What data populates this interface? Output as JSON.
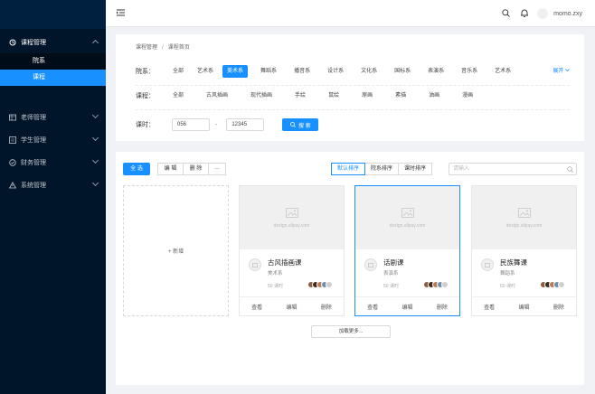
{
  "header": {
    "user_name": "momo.zxy"
  },
  "sidebar": {
    "groups": [
      {
        "label": "课程管理",
        "icon": "course-icon",
        "open": true,
        "items": [
          {
            "label": "院系"
          },
          {
            "label": "课程"
          }
        ]
      },
      {
        "label": "老师管理",
        "icon": "teacher-icon"
      },
      {
        "label": "学生管理",
        "icon": "student-icon"
      },
      {
        "label": "财务管理",
        "icon": "finance-icon"
      },
      {
        "label": "系统管理",
        "icon": "system-icon"
      }
    ]
  },
  "breadcrumb": {
    "root": "课程管理",
    "sep": "/",
    "current": "课程首页"
  },
  "filters": {
    "dept_label": "院系：",
    "depts": [
      "全部",
      "艺术系",
      "美术系",
      "舞蹈系",
      "播音系",
      "设计系",
      "文化系",
      "国标系",
      "表演系",
      "音乐系",
      "艺术系"
    ],
    "selected_dept_index": 2,
    "expand_label": "展开",
    "course_label": "课程：",
    "courses": [
      "全部",
      "古风插画",
      "现代插画",
      "手绘",
      "鼠绘",
      "原画",
      "素描",
      "油画",
      "漫画"
    ],
    "hours_label": "课时：",
    "hours_from": "056",
    "hours_sep": "-",
    "hours_to": "12345",
    "search_button": "搜 索"
  },
  "toolbar": {
    "select_all": "全 选",
    "edit": "编 辑",
    "delete": "删 除",
    "more": "···",
    "sorts": [
      "默认排序",
      "院系排序",
      "课时排序"
    ],
    "active_sort_index": 0,
    "search_placeholder": "请输入"
  },
  "add_card_label": "+ 新增",
  "cards": [
    {
      "title": "古风插画课",
      "dept": "美术系",
      "hours": "50 课时",
      "image_caption": "design.alipay.com",
      "actions": [
        "查看",
        "编辑",
        "删除"
      ],
      "active": false
    },
    {
      "title": "话剧课",
      "dept": "表演系",
      "hours": "50 课时",
      "image_caption": "design.alipay.com",
      "actions": [
        "查看",
        "编辑",
        "删除"
      ],
      "active": true
    },
    {
      "title": "民族舞课",
      "dept": "舞蹈系",
      "hours": "50 课时",
      "image_caption": "design.alipay.com",
      "actions": [
        "查看",
        "编辑",
        "删除"
      ],
      "active": false
    }
  ],
  "load_more": "加载更多...",
  "colors": {
    "primary": "#1890ff",
    "sidebar_bg": "#001529",
    "submenu_bg": "#000c17"
  }
}
